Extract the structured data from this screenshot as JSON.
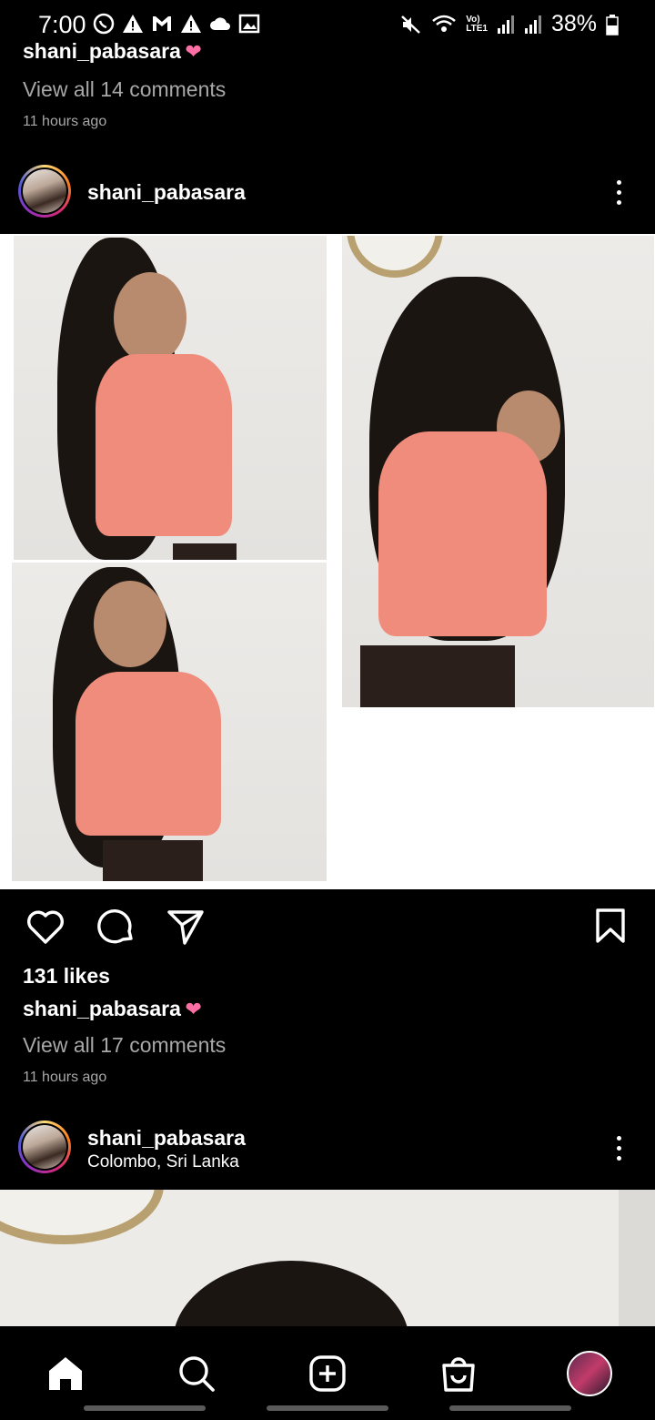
{
  "status_bar": {
    "time": "7:00",
    "battery": "38%",
    "volte_label": "Vo)",
    "lte_label": "LTE1"
  },
  "previous_post": {
    "caption_user": "shani_pabasara",
    "view_comments": "View all 14 comments",
    "time_ago": "11 hours ago"
  },
  "post1": {
    "username": "shani_pabasara",
    "likes": "131 likes",
    "caption_user": "shani_pabasara",
    "view_comments": "View all 17 comments",
    "time_ago": "11 hours ago"
  },
  "post2": {
    "username": "shani_pabasara",
    "location": "Colombo, Sri Lanka"
  },
  "bottom_nav": {
    "items": [
      "home-icon",
      "search-icon",
      "create-icon",
      "shop-icon",
      "profile-avatar"
    ]
  },
  "colors": {
    "background": "#000000",
    "secondary_text": "#a8a8a8",
    "shirt": "#f08c7c"
  }
}
